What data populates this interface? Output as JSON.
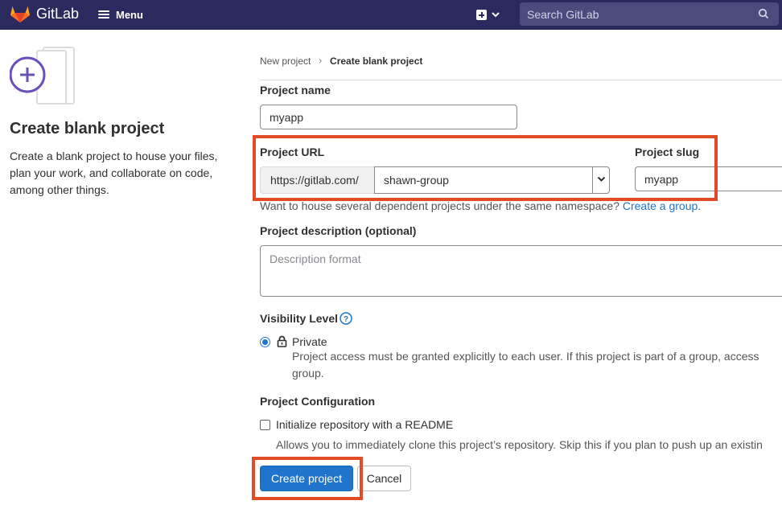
{
  "navbar": {
    "brand": "GitLab",
    "menu_label": "Menu",
    "search_placeholder": "Search GitLab",
    "bg_color": "#2b2a5e"
  },
  "left_panel": {
    "title": "Create blank project",
    "description": "Create a blank project to house your files, plan your work, and collaborate on code, among other things."
  },
  "breadcrumb": {
    "parent": "New project",
    "current": "Create blank project"
  },
  "form": {
    "project_name_label": "Project name",
    "project_name_value": "myapp",
    "project_url_label": "Project URL",
    "url_prefix": "https://gitlab.com/",
    "namespace_value": "shawn-group",
    "project_slug_label": "Project slug",
    "project_slug_value": "myapp",
    "namespace_help": "Want to house several dependent projects under the same namespace?",
    "namespace_help_link": "Create a group.",
    "description_label": "Project description (optional)",
    "description_placeholder": "Description format",
    "visibility_label": "Visibility Level",
    "visibility_private_label": "Private",
    "visibility_private_desc_line1": "Project access must be granted explicitly to each user. If this project is part of a group, access",
    "visibility_private_desc_line2": "group.",
    "config_label": "Project Configuration",
    "readme_label": "Initialize repository with a README",
    "readme_help": "Allows you to immediately clone this project’s repository. Skip this if you plan to push up an existin",
    "readme_checked": false,
    "visibility_selected": "Private"
  },
  "actions": {
    "create_label": "Create project",
    "cancel_label": "Cancel"
  },
  "colors": {
    "primary": "#1f75cb",
    "highlight": "#e24b26",
    "link": "#1f75cb"
  }
}
